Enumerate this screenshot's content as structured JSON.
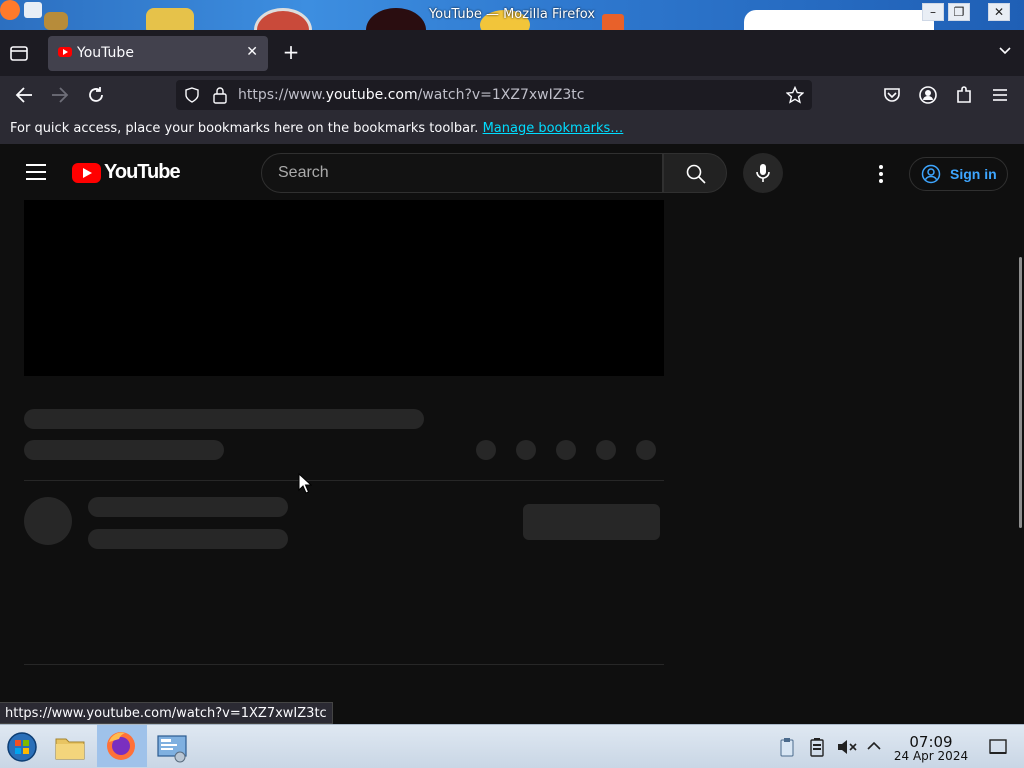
{
  "window": {
    "title": "YouTube — Mozilla Firefox",
    "controls": [
      "minimize",
      "maximize",
      "close"
    ]
  },
  "browser": {
    "tabs": [
      {
        "label": "YouTube",
        "active": true,
        "favicon": "youtube-icon"
      }
    ],
    "url": {
      "prefix": "https://www.",
      "host": "youtube.com",
      "path": "/watch?v=1XZ7xwIZ3tc"
    },
    "bookmarks_bar": {
      "message": "For quick access, place your bookmarks here on the bookmarks toolbar.",
      "link": "Manage bookmarks…"
    },
    "status_link": "https://www.youtube.com/watch?v=1XZ7xwIZ3tc"
  },
  "youtube": {
    "logo_text": "YouTube",
    "search_placeholder": "Search",
    "sign_in_label": "Sign in",
    "accent_color": "#ff0000",
    "link_color": "#3ea6ff"
  },
  "taskbar": {
    "apps": [
      "start-orb-icon",
      "file-manager-icon",
      "firefox-icon",
      "system-settings-icon"
    ],
    "tray": [
      "clipboard-icon",
      "battery-icon",
      "volume-muted-icon",
      "tray-expand-icon"
    ],
    "clock_time": "07:09",
    "clock_date": "24 Apr 2024"
  }
}
